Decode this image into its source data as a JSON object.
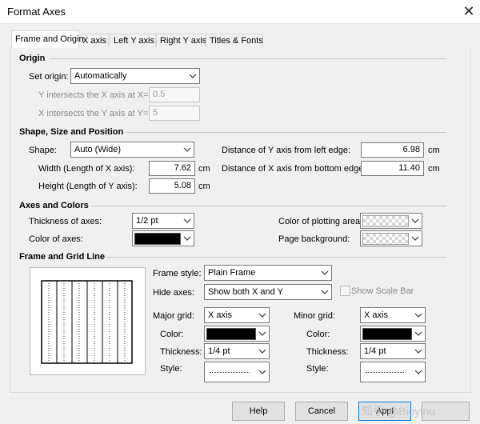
{
  "window": {
    "title": "Format Axes",
    "close_glyph": "✕"
  },
  "tabs": [
    {
      "label": "Frame and Origin",
      "active": true
    },
    {
      "label": "X axis"
    },
    {
      "label": "Left Y axis"
    },
    {
      "label": "Right Y axis"
    },
    {
      "label": "Titles & Fonts"
    }
  ],
  "origin": {
    "heading": "Origin",
    "set_origin_label": "Set origin:",
    "set_origin_value": "Automatically",
    "y_intersects_label": "Y intersects the X axis at X=",
    "y_intersects_value": "0.5",
    "x_intersects_label": "X intersects the Y axis at Y=",
    "x_intersects_value": "5"
  },
  "shape": {
    "heading": "Shape, Size and Position",
    "shape_label": "Shape:",
    "shape_value": "Auto (Wide)",
    "width_label": "Width (Length of X axis):",
    "width_value": "7.62",
    "height_label": "Height (Length of Y axis):",
    "height_value": "5.08",
    "unit": "cm",
    "dist_y_label": "Distance of Y axis from left edge:",
    "dist_y_value": "6.98",
    "dist_x_label": "Distance of X axis from bottom edge:",
    "dist_x_value": "11.40"
  },
  "axes_colors": {
    "heading": "Axes and Colors",
    "thickness_label": "Thickness of axes:",
    "thickness_value": "1/2 pt",
    "color_label": "Color of axes:",
    "color_value": "#000000",
    "plot_area_label": "Color of plotting area:",
    "page_bg_label": "Page background:"
  },
  "frame_grid": {
    "heading": "Frame and Grid Line",
    "frame_style_label": "Frame style:",
    "frame_style_value": "Plain Frame",
    "hide_axes_label": "Hide axes:",
    "hide_axes_value": "Show both X and Y",
    "show_scale_bar_label": "Show Scale Bar",
    "major_grid_label": "Major grid:",
    "major_grid_value": "X axis",
    "minor_grid_label": "Minor grid:",
    "minor_grid_value": "X axis",
    "color_label": "Color:",
    "thickness_label": "Thickness:",
    "style_label": "Style:",
    "major_thickness_value": "1/4 pt",
    "minor_thickness_value": "1/4 pt",
    "major_color_value": "#000000",
    "minor_color_value": "#000000"
  },
  "buttons": {
    "help": "Help",
    "cancel": "Cancel",
    "apply": "Appl"
  },
  "watermark": "知乎 @Bioylnu"
}
